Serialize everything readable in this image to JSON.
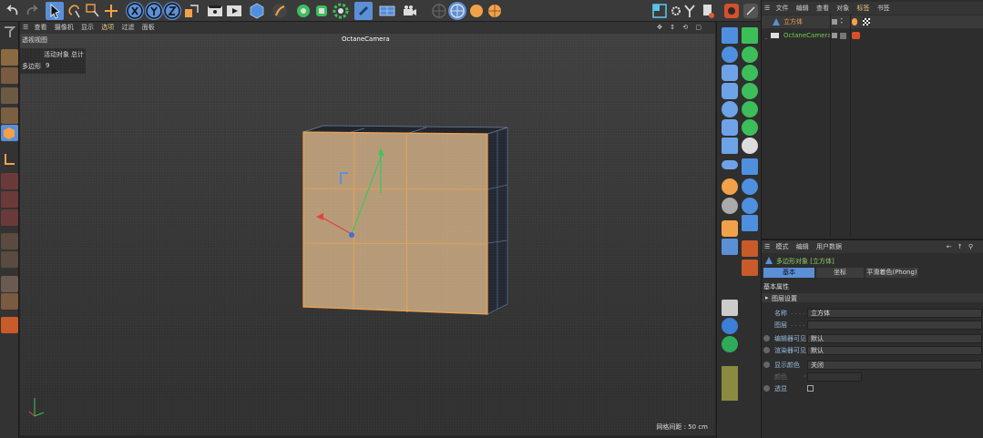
{
  "viewport_menu": [
    "查看",
    "摄像机",
    "显示",
    "选项",
    "过滤",
    "面板"
  ],
  "viewport": {
    "name": "透视视图",
    "camera": "OctaneCamera",
    "hud_active_label": "活动对象",
    "hud_total_label": "总计",
    "hud_poly_label": "多边形",
    "hud_poly_value": "9",
    "grid_spacing": "网格间距 : 50 cm"
  },
  "object_manager": {
    "menu": [
      "文件",
      "编辑",
      "查看",
      "对象",
      "标签",
      "书签"
    ],
    "objects": [
      "立方体",
      "OctaneCamera"
    ]
  },
  "attribute_manager": {
    "menu": [
      "模式",
      "编辑",
      "用户数据"
    ],
    "object_title": "多边形对象 [立方体]",
    "tabs": [
      "基本",
      "坐标",
      "平滑着色(Phong)"
    ],
    "section": "基本属性",
    "group": "图层设置",
    "name_label": "名称",
    "name_value": "立方体",
    "layer_label": "图层",
    "editor_vis_label": "编辑器可见",
    "editor_vis_value": "默认",
    "render_vis_label": "渲染器可见",
    "render_vis_value": "默认",
    "display_color_label": "显示颜色",
    "display_color_value": "关闭",
    "color_label": "颜色",
    "xray_label": "透显"
  },
  "colors": {
    "accent": "#5b8fd6",
    "selection": "#f2a14a",
    "green": "#6ecf4a"
  }
}
